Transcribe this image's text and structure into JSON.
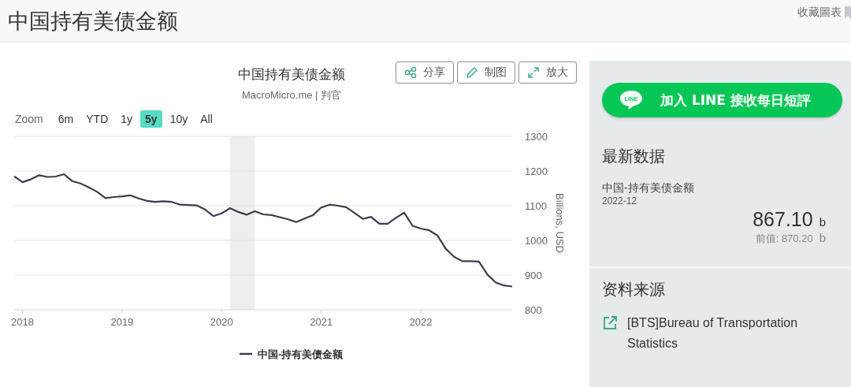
{
  "header": {
    "title": "中国持有美债金额",
    "bookmark_label": "收藏圖表"
  },
  "chart_panel": {
    "title": "中国持有美债金额",
    "subtitle": "MacroMicro.me | 判官",
    "actions": [
      {
        "label": "分享",
        "kind": "share"
      },
      {
        "label": "制图",
        "kind": "edit"
      },
      {
        "label": "放大",
        "kind": "expand"
      }
    ],
    "zoom": {
      "label": "Zoom",
      "options": [
        {
          "label": "6m",
          "selected": false
        },
        {
          "label": "YTD",
          "selected": false
        },
        {
          "label": "1y",
          "selected": false
        },
        {
          "label": "5y",
          "selected": true
        },
        {
          "label": "10y",
          "selected": false
        },
        {
          "label": "All",
          "selected": false
        }
      ]
    },
    "chart_data": {
      "type": "line",
      "ylabel": "Billions, USD",
      "x": [
        2017.917,
        2018,
        2018.083,
        2018.167,
        2018.25,
        2018.333,
        2018.417,
        2018.5,
        2018.583,
        2018.667,
        2018.75,
        2018.833,
        2018.917,
        2019,
        2019.083,
        2019.167,
        2019.25,
        2019.333,
        2019.417,
        2019.5,
        2019.583,
        2019.667,
        2019.75,
        2019.833,
        2019.917,
        2020,
        2020.083,
        2020.167,
        2020.25,
        2020.333,
        2020.417,
        2020.5,
        2020.583,
        2020.667,
        2020.75,
        2020.833,
        2020.917,
        2021,
        2021.083,
        2021.167,
        2021.25,
        2021.333,
        2021.417,
        2021.5,
        2021.583,
        2021.667,
        2021.75,
        2021.833,
        2021.917,
        2022,
        2022.083,
        2022.167,
        2022.25,
        2022.333,
        2022.417,
        2022.5,
        2022.583,
        2022.667,
        2022.75,
        2022.833,
        2022.917
      ],
      "series": [
        {
          "name": "中国-持有美债金额",
          "color": "#3b3e4d",
          "values": [
            1185,
            1168,
            1176,
            1188,
            1183,
            1184,
            1191,
            1171,
            1164,
            1153,
            1140,
            1122,
            1125,
            1127,
            1130,
            1121,
            1114,
            1111,
            1113,
            1111,
            1103,
            1102,
            1101,
            1089,
            1070,
            1078,
            1093,
            1082,
            1074,
            1084,
            1075,
            1073,
            1067,
            1061,
            1053,
            1063,
            1073,
            1095,
            1103,
            1100,
            1096,
            1079,
            1062,
            1068,
            1048,
            1048,
            1065,
            1080,
            1042,
            1034,
            1029,
            1014,
            976,
            953,
            940,
            940,
            939,
            902,
            879,
            870,
            867
          ]
        }
      ],
      "xlim": [
        2017.917,
        2022.917
      ],
      "ylim": [
        800,
        1300
      ],
      "yticks": [
        800,
        900,
        1000,
        1100,
        1200,
        1300
      ],
      "xticks": [
        2018,
        2019,
        2020,
        2021,
        2022
      ],
      "grid": true,
      "bands": [
        {
          "axis": "x",
          "from": 2020.083,
          "to": 2020.333
        }
      ]
    }
  },
  "side_panel": {
    "line_button": {
      "icon_text": "LINE",
      "label": "加入 LINE 接收每日短評"
    },
    "latest": {
      "heading": "最新数据",
      "series": "中国-持有美债金额",
      "date": "2022-12",
      "value": "867.10",
      "unit": "b",
      "previous_label": "前值:",
      "previous_value": "870.20",
      "previous_unit": "b"
    },
    "source": {
      "heading": "资料来源",
      "link": "[BTS]Bureau of Transportation Statistics"
    }
  }
}
